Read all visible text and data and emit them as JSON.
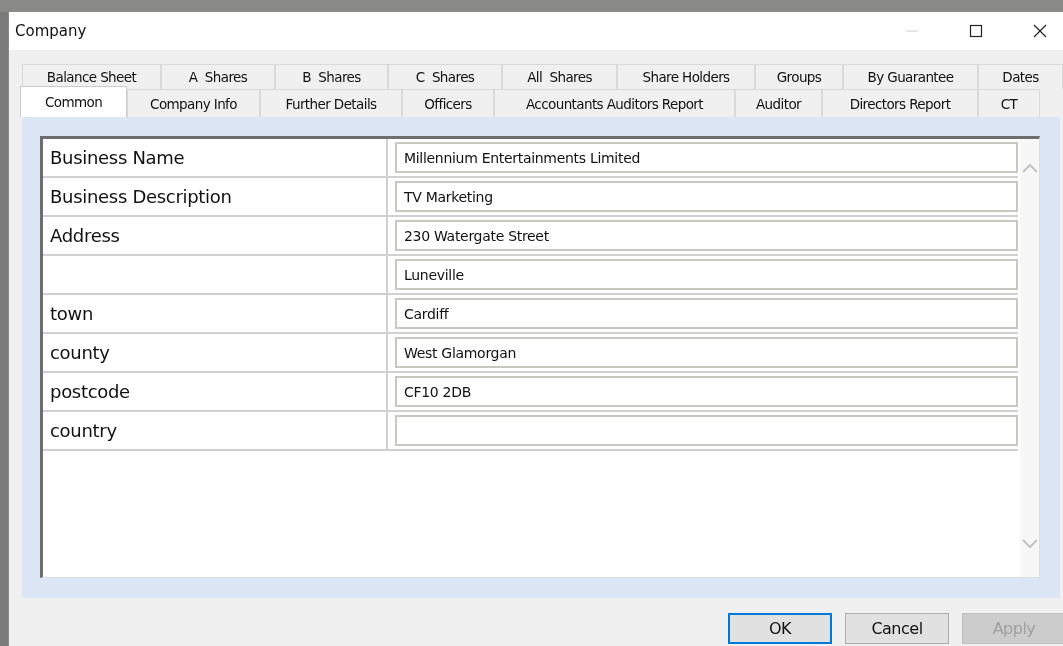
{
  "window": {
    "title": "Company"
  },
  "tab_rows": [
    [
      {
        "label": "Balance Sheet",
        "selected": false
      },
      {
        "label": "A  Shares",
        "selected": false
      },
      {
        "label": "B  Shares",
        "selected": false
      },
      {
        "label": "C  Shares",
        "selected": false
      },
      {
        "label": "All  Shares",
        "selected": false
      },
      {
        "label": "Share Holders",
        "selected": false
      },
      {
        "label": "Groups",
        "selected": false
      },
      {
        "label": "By Guarantee",
        "selected": false
      },
      {
        "label": "Dates",
        "selected": false
      }
    ],
    [
      {
        "label": "Common",
        "selected": true
      },
      {
        "label": "Company Info",
        "selected": false
      },
      {
        "label": "Further Details",
        "selected": false
      },
      {
        "label": "Officers",
        "selected": false
      },
      {
        "label": "Accountants Auditors Report",
        "selected": false
      },
      {
        "label": "Auditor",
        "selected": false
      },
      {
        "label": "Directors Report",
        "selected": false
      },
      {
        "label": "CT",
        "selected": false
      }
    ]
  ],
  "fields": [
    {
      "label": "Business Name",
      "value": "Millennium Entertainments Limited"
    },
    {
      "label": "Business Description",
      "value": "TV Marketing"
    },
    {
      "label": "Address",
      "value": "230 Watergate Street"
    },
    {
      "value": "Luneville"
    },
    {
      "label": "town",
      "value": "Cardiff"
    },
    {
      "label": "county",
      "value": "West Glamorgan"
    },
    {
      "label": "postcode",
      "value": "CF10 2DB"
    },
    {
      "label": "country"
    }
  ],
  "buttons": [
    {
      "label": "OK",
      "default": true,
      "disabled": false
    },
    {
      "label": "Cancel",
      "default": false,
      "disabled": false
    },
    {
      "label": "Apply",
      "default": false,
      "disabled": true
    }
  ]
}
